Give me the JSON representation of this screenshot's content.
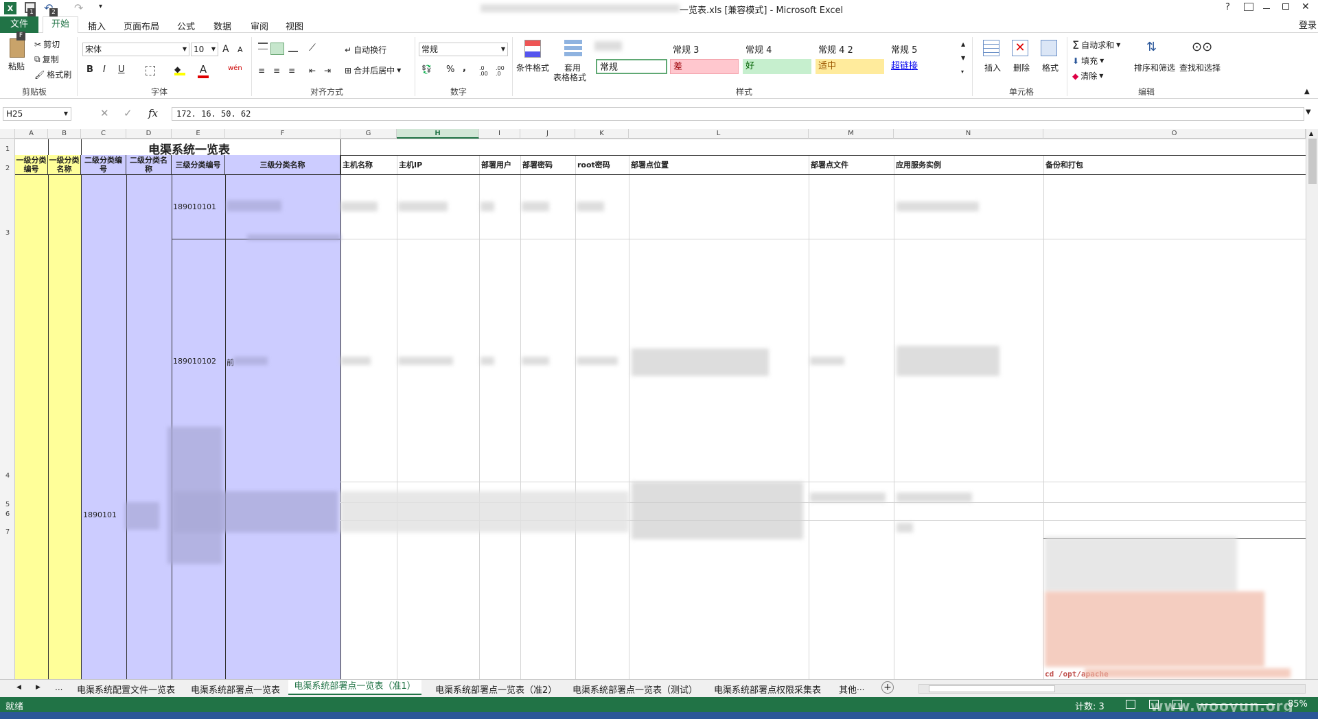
{
  "window": {
    "title": "一览表.xls  [兼容模式] - Microsoft Excel",
    "help": "?",
    "qat_badge_1": "1",
    "qat_badge_2": "2",
    "file_badge": "F",
    "login": "登录"
  },
  "menu": {
    "file": "文件",
    "tabs": [
      "开始",
      "插入",
      "页面布局",
      "公式",
      "数据",
      "审阅",
      "视图"
    ]
  },
  "ribbon": {
    "clipboard": {
      "paste": "粘贴",
      "cut": "剪切",
      "copy": "复制",
      "format_painter": "格式刷",
      "label": "剪贴板"
    },
    "font": {
      "name": "宋体",
      "size": "10",
      "bold": "B",
      "italic": "I",
      "underline": "U",
      "label": "字体",
      "grow": "A",
      "shrink": "A",
      "font_color_glyph": "A",
      "phonetic": "wén"
    },
    "alignment": {
      "wrap": "自动换行",
      "merge": "合并后居中",
      "label": "对齐方式"
    },
    "number": {
      "format": "常规",
      "percent": "%",
      "comma": ",",
      "label": "数字",
      "inc_decimal": ".0 .00",
      "dec_decimal": ".00 .0"
    },
    "styles": {
      "conditional": "条件格式",
      "table_format_1": "套用",
      "table_format_2": "表格格式",
      "label": "样式",
      "items": [
        {
          "label": "常规 3"
        },
        {
          "label": "常规 4"
        },
        {
          "label": "常规 4 2"
        },
        {
          "label": "常规 5"
        },
        {
          "label": "常规"
        },
        {
          "label": "差"
        },
        {
          "label": "好"
        },
        {
          "label": "适中"
        },
        {
          "label": "超链接"
        }
      ]
    },
    "cells": {
      "insert": "插入",
      "delete": "删除",
      "format": "格式",
      "label": "单元格"
    },
    "editing": {
      "autosum": "自动求和",
      "fill": "填充",
      "clear": "清除",
      "sort": "排序和筛选",
      "find": "查找和选择",
      "label": "编辑"
    }
  },
  "formula_bar": {
    "name_box": "H25",
    "fx": "fx",
    "value": "172. 16. 50. 62",
    "cancel": "✕",
    "enter": "✓"
  },
  "columns": [
    "A",
    "B",
    "C",
    "D",
    "E",
    "F",
    "G",
    "H",
    "I",
    "J",
    "K",
    "L",
    "M",
    "N",
    "O"
  ],
  "rows": [
    "1",
    "2",
    "3",
    "4",
    "5",
    "6",
    "7"
  ],
  "sheet": {
    "title": "电渠系统一览表",
    "headers": [
      "一级分类编号",
      "一级分类名称",
      "二级分类编号",
      "二级分类名称",
      "三级分类编号",
      "三级分类名称",
      "主机名称",
      "主机IP",
      "部署用户",
      "部署密码",
      "root密码",
      "部署点位置",
      "部署点文件",
      "应用服务实例",
      "备份和打包"
    ],
    "cells": {
      "e3": "189010101",
      "e4": "189010102",
      "f4": "前",
      "c_merged": "1890101",
      "o_code": "cd /opt/apache"
    }
  },
  "sheet_tabs": {
    "nav_left": "◀",
    "nav_right": "▶",
    "more": "...",
    "tabs": [
      "电渠系统配置文件一览表",
      "电渠系统部署点一览表",
      "电渠系统部署点一览表（准1）",
      "电渠系统部署点一览表（准2）",
      "电渠系统部署点一览表（测试）",
      "电渠系统部署点权限采集表",
      "其他"
    ],
    "more_right": "...",
    "add": "+"
  },
  "status": {
    "ready": "就绪",
    "count": "计数: 3",
    "zoom": "85%",
    "watermark": "www.wooyun.org"
  }
}
